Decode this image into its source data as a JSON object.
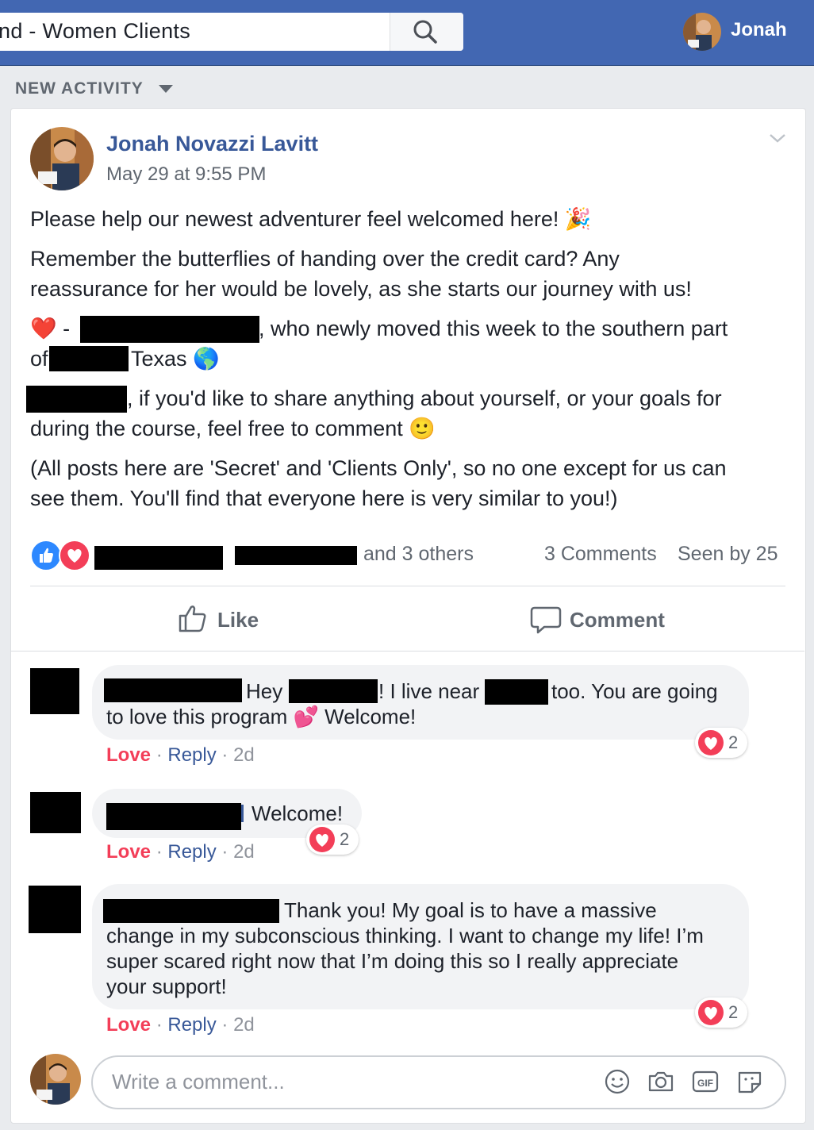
{
  "search": {
    "text": "nd - Women Clients"
  },
  "profile": {
    "name": "Jonah"
  },
  "feed": {
    "label": "NEW ACTIVITY"
  },
  "post": {
    "author": "Jonah Novazzi Lavitt",
    "time": "May 29 at 9:55 PM",
    "line1": "Please help our newest adventurer feel welcomed here! 🎉",
    "line2": "Remember the butterflies of handing over the credit card? Any",
    "line3": "reassurance for her would be lovely, as she starts our journey with us!",
    "line4a": "❤️ -",
    "line4b": ", who newly moved this week to the southern part",
    "line5a": "of",
    "line5b": "Texas 🌎",
    "line6": ", if you'd like to share anything about yourself, or your goals for",
    "line7": "during the course, feel free to comment 🙂",
    "line8": "(All posts here are 'Secret' and 'Clients Only', so no one except for us can",
    "line9": "see them. You'll find that everyone here is very similar to you!)"
  },
  "stats": {
    "others": "and 3 others",
    "comments": "3 Comments",
    "seen": "Seen by 25"
  },
  "actions": {
    "like": "Like",
    "comment": "Comment"
  },
  "comments": [
    {
      "p1": "Hey",
      "p2": "! I live near",
      "p3": "too. You are going",
      "l2": "to love this program 💕 Welcome!",
      "love": "Love",
      "reply": "Reply",
      "time": "2d",
      "reactions": "2"
    },
    {
      "p1": "Welcome!",
      "love": "Love",
      "reply": "Reply",
      "time": "2d",
      "reactions": "2"
    },
    {
      "p1": "Thank you! My goal is to have a massive",
      "l2": "change in my subconscious thinking. I want to change my life! I’m",
      "l3": "super scared right now that I’m doing this so I really appreciate",
      "l4": "your support!",
      "love": "Love",
      "reply": "Reply",
      "time": "2d",
      "reactions": "2"
    }
  ],
  "composer": {
    "placeholder": "Write a comment..."
  },
  "icons": [
    "search-icon",
    "chevron-down-icon",
    "like-reaction-icon",
    "love-reaction-icon",
    "thumbs-up-icon",
    "comment-icon",
    "emoji-icon",
    "camera-icon",
    "gif-icon",
    "sticker-icon"
  ],
  "colors": {
    "brand": "#4267b2",
    "link": "#385898",
    "love": "#f33e58",
    "like": "#2d88ff"
  }
}
